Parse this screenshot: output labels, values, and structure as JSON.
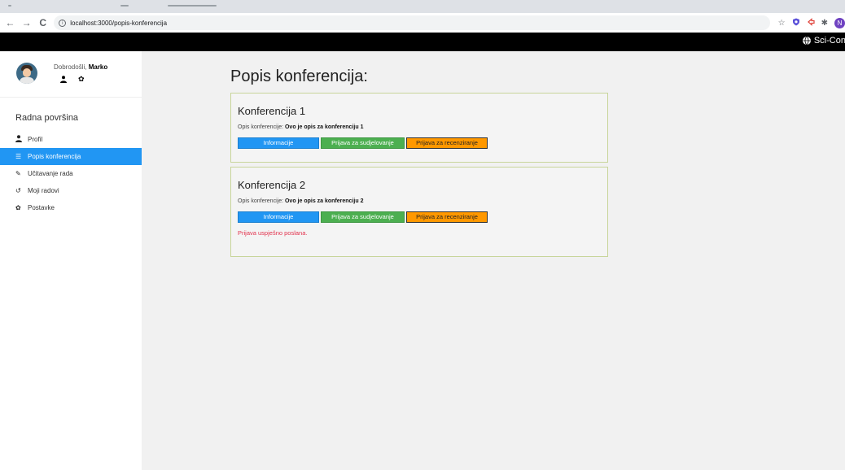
{
  "browser": {
    "back": "←",
    "forward": "→",
    "reload": "C",
    "url": "localhost:3000/popis-konferencija",
    "ext_star": "☆",
    "ext_puzzle": "✱",
    "profile_initial": "N"
  },
  "app": {
    "brand": "Sci-Conf"
  },
  "sidebar": {
    "welcome_prefix": "Dobrodošli,",
    "user_name": "Marko",
    "section_title": "Radna površina",
    "items": [
      {
        "label": "Profil",
        "icon": "user-icon",
        "active": false
      },
      {
        "label": "Popis konferencija",
        "icon": "list-icon",
        "active": true
      },
      {
        "label": "Učitavanje rada",
        "icon": "edit-icon",
        "active": false
      },
      {
        "label": "Moji radovi",
        "icon": "history-icon",
        "active": false
      },
      {
        "label": "Postavke",
        "icon": "gear-icon",
        "active": false
      }
    ]
  },
  "main": {
    "title": "Popis konferencija:",
    "desc_label": "Opis konferencije:",
    "btn_info": "Informacije",
    "btn_participate": "Prijava za sudjelovanje",
    "btn_review": "Prijava za recenziranje",
    "conferences": [
      {
        "title": "Konferencija 1",
        "description": "Ovo je opis za konferenciju 1",
        "status": ""
      },
      {
        "title": "Konferencija 2",
        "description": "Ovo je opis za konferenciju 2",
        "status": "Prijava uspješno poslana."
      }
    ]
  },
  "colors": {
    "accent": "#2196f3",
    "success_btn": "#4caf50",
    "warning_btn": "#ff9800",
    "status_text": "#e2324d"
  }
}
